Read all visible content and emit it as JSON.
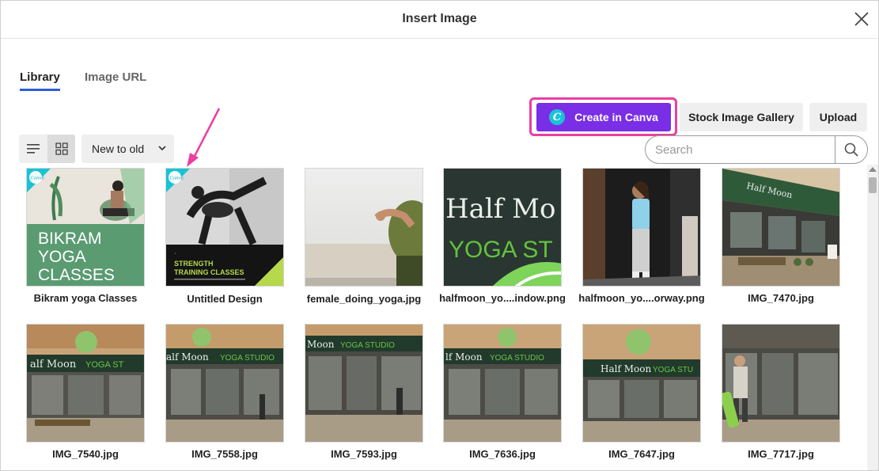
{
  "dialog": {
    "title": "Insert Image"
  },
  "tabs": [
    {
      "label": "Library",
      "active": true
    },
    {
      "label": "Image URL",
      "active": false
    }
  ],
  "toolbar": {
    "create_canva_label": "Create in Canva",
    "canva_badge": "C",
    "stock_gallery_label": "Stock Image Gallery",
    "upload_label": "Upload",
    "sort_value": "New to old"
  },
  "search": {
    "placeholder": "Search",
    "value": ""
  },
  "colors": {
    "canva_button": "#7a2ee6",
    "highlight": "#ea3fa0",
    "tab_underline": "#2b5fd9",
    "canva_badge": "#19c3d6"
  },
  "images": [
    {
      "name": "Bikram yoga Classes",
      "tile_text": [
        "BIKRAM",
        "YOGA",
        "CLASSES"
      ],
      "brand": "Canva"
    },
    {
      "name": "Untitled Design",
      "tile_text": [
        "STRENGTH",
        "TRAINING CLASSES"
      ],
      "brand": "Canva"
    },
    {
      "name": "female_doing_yoga.jpg"
    },
    {
      "name": "halfmoon_yo....indow.png",
      "tile_text": [
        "Half Mo",
        "YOGA ST"
      ]
    },
    {
      "name": "halfmoon_yo....orway.png"
    },
    {
      "name": "IMG_7470.jpg"
    },
    {
      "name": "IMG_7540.jpg"
    },
    {
      "name": "IMG_7558.jpg"
    },
    {
      "name": "IMG_7593.jpg"
    },
    {
      "name": "IMG_7636.jpg"
    },
    {
      "name": "IMG_7647.jpg"
    },
    {
      "name": "IMG_7717.jpg"
    }
  ]
}
